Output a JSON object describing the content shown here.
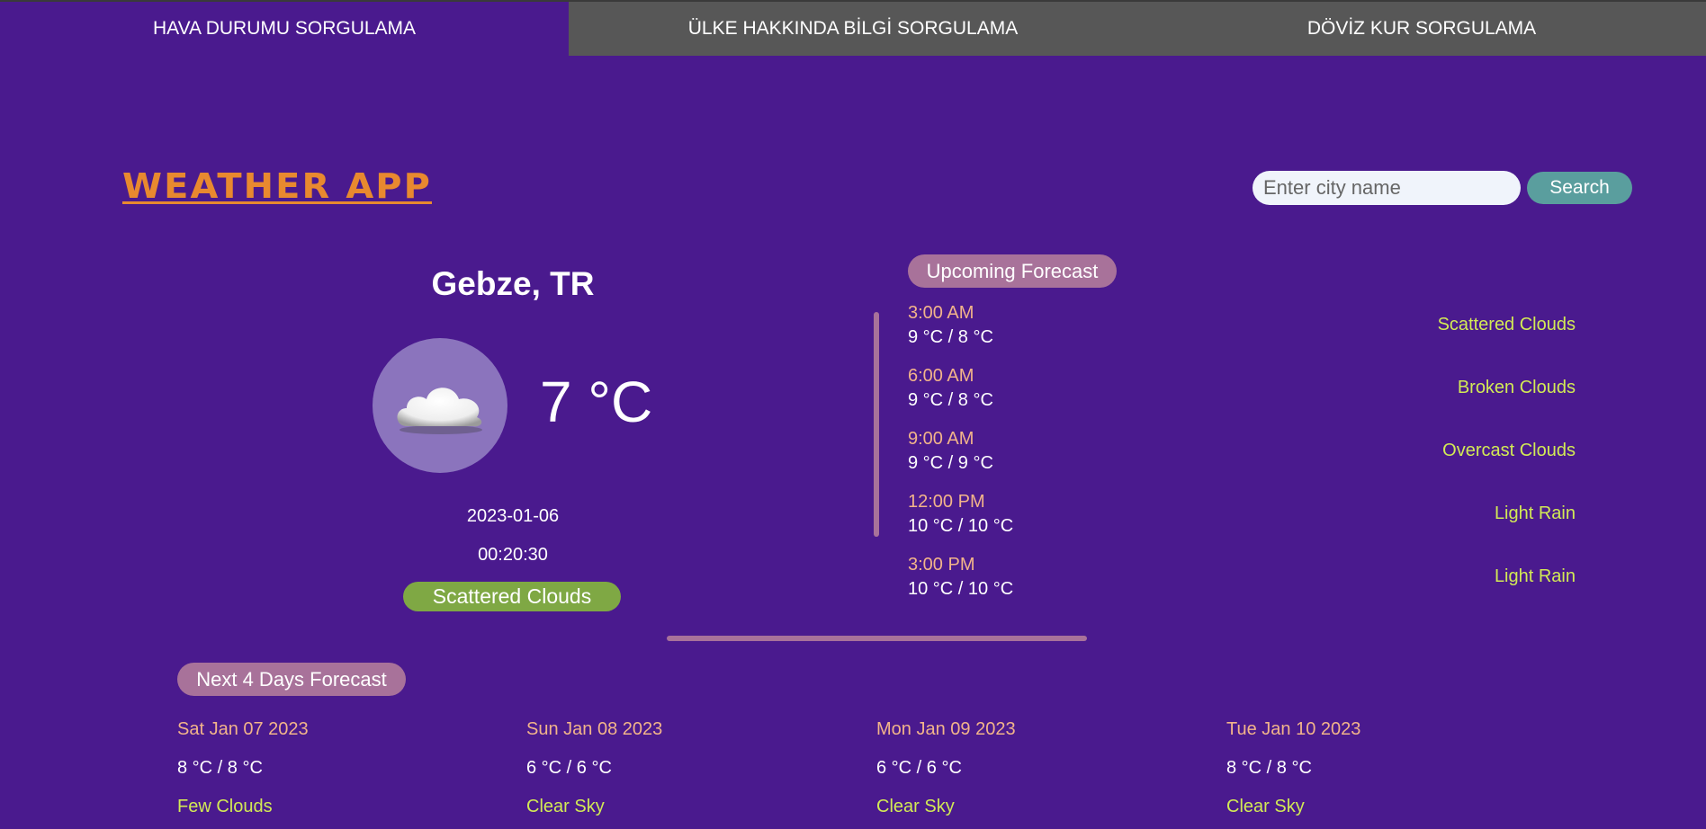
{
  "tabs": [
    {
      "label": "HAVA DURUMU SORGULAMA",
      "active": true
    },
    {
      "label": "ÜLKE HAKKINDA BİLGİ SORGULAMA",
      "active": false
    },
    {
      "label": "DÖVİZ KUR SORGULAMA",
      "active": false
    }
  ],
  "header": {
    "title": "WEATHER APP",
    "search_placeholder": "Enter city name",
    "search_label": "Search"
  },
  "current": {
    "city": "Gebze, TR",
    "icon": "cloud-icon",
    "temperature": "7 °C",
    "date": "2023-01-06",
    "time": "00:20:30",
    "description": "Scattered Clouds"
  },
  "upcoming": {
    "title": "Upcoming Forecast",
    "items": [
      {
        "time": "3:00 AM",
        "temp": "9 °C / 8 °C",
        "desc": "Scattered Clouds"
      },
      {
        "time": "6:00 AM",
        "temp": "9 °C / 8 °C",
        "desc": "Broken Clouds"
      },
      {
        "time": "9:00 AM",
        "temp": "9 °C / 9 °C",
        "desc": "Overcast Clouds"
      },
      {
        "time": "12:00 PM",
        "temp": "10 °C / 10 °C",
        "desc": "Light Rain"
      },
      {
        "time": "3:00 PM",
        "temp": "10 °C / 10 °C",
        "desc": "Light Rain"
      }
    ]
  },
  "next_days": {
    "title": "Next 4 Days Forecast",
    "items": [
      {
        "date": "Sat Jan 07 2023",
        "temp": "8 °C / 8 °C",
        "desc": "Few Clouds"
      },
      {
        "date": "Sun Jan 08 2023",
        "temp": "6 °C / 6 °C",
        "desc": "Clear Sky"
      },
      {
        "date": "Mon Jan 09 2023",
        "temp": "6 °C / 6 °C",
        "desc": "Clear Sky"
      },
      {
        "date": "Tue Jan 10 2023",
        "temp": "8 °C / 8 °C",
        "desc": "Clear Sky"
      }
    ]
  },
  "colors": {
    "background": "#4a1a8e",
    "tab_inactive": "#575757",
    "title": "#e8892f",
    "accent_pill": "#a8729a",
    "desc_pill": "#7fa844",
    "time_text": "#f2b48a",
    "desc_text": "#d2ea55",
    "search_button": "#5a9e9e"
  }
}
